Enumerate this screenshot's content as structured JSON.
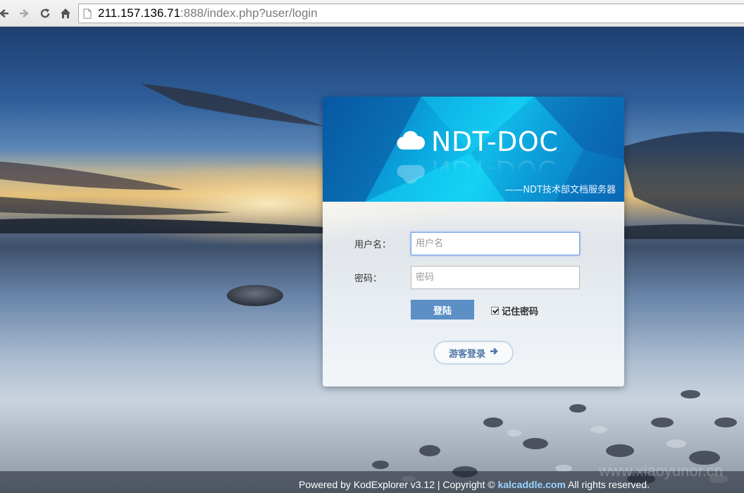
{
  "browser": {
    "url_host": "211.157.136.71",
    "url_rest": ":888/index.php?user/login"
  },
  "header": {
    "brand": "NDT-DOC",
    "subtitle": "——NDT技术部文档服务器"
  },
  "form": {
    "username_label": "用户名：",
    "username_placeholder": "用户名",
    "password_label": "密码：",
    "password_placeholder": "密码",
    "login_label": "登陆",
    "remember_label": "记住密码",
    "remember_checked": true,
    "guest_label": "游客登录"
  },
  "footer": {
    "prefix": "Powered by KodExplorer v3.12 | Copyright © ",
    "link": "kalcaddle.com",
    "suffix": " All rights reserved."
  },
  "watermark": "www.xiaoyunor.cn",
  "icons": {
    "back": "back-arrow-icon",
    "forward": "forward-arrow-icon",
    "reload": "reload-icon",
    "home": "home-icon",
    "page": "page-icon",
    "cloud": "cloud-icon",
    "guest_arrow": "arrow-right-icon"
  },
  "colors": {
    "header_blue": "#0aa6de",
    "login_button": "#5b8fc6",
    "guest_text": "#4f75a6"
  }
}
